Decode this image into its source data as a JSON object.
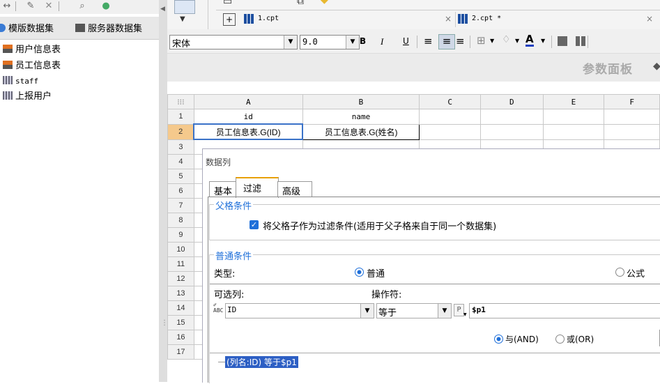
{
  "left_panel": {
    "tabs": [
      "模版数据集",
      "服务器数据集"
    ],
    "datasets": [
      {
        "label": "用户信息表",
        "icon": "db-table-icon"
      },
      {
        "label": "员工信息表",
        "icon": "db-table-icon"
      },
      {
        "label": "staff",
        "icon": "embedded-table-icon"
      },
      {
        "label": "上报用户",
        "icon": "embedded-table-icon"
      }
    ]
  },
  "editor_tabs": [
    {
      "label": "1.cpt",
      "close": "×"
    },
    {
      "label": "2.cpt *",
      "close": "×"
    }
  ],
  "format_bar": {
    "font_name": "宋体",
    "font_size": "9.0",
    "bold": "B",
    "italic": "I",
    "underline": "U",
    "font_color_glyph": "A"
  },
  "param_panel": {
    "label": "参数面板"
  },
  "sheet": {
    "corner": "⁝⁝⁝",
    "columns": [
      "A",
      "B",
      "C",
      "D",
      "E",
      "F"
    ],
    "rows": [
      "1",
      "2",
      "3",
      "4",
      "5",
      "6",
      "7",
      "8",
      "9",
      "10",
      "11",
      "12",
      "13",
      "14",
      "15",
      "16",
      "17"
    ],
    "cells": {
      "A1": "id",
      "B1": "name",
      "A2": "员工信息表.G(ID)",
      "B2": "员工信息表.G(姓名)"
    }
  },
  "dialog": {
    "title": "数据列",
    "tabs": [
      "基本",
      "过滤",
      "高级"
    ],
    "active_tab": "过滤",
    "parent_section": {
      "legend": "父格条件",
      "checkbox_label": "将父格子作为过滤条件(适用于父子格来自于同一个数据集)",
      "checked": true
    },
    "normal_section": {
      "legend": "普通条件",
      "type_label": "类型:",
      "type_options": [
        {
          "label": "普通",
          "selected": true
        },
        {
          "label": "公式",
          "selected": false
        }
      ],
      "column_label": "可选列:",
      "operator_label": "操作符:",
      "column_value": "ID",
      "operator_value": "等于",
      "param_badge": "P",
      "value_text": "$p1",
      "logic_options": [
        {
          "label": "与(AND)",
          "selected": true
        },
        {
          "label": "或(OR)",
          "selected": false
        }
      ],
      "condition_tree": [
        "(列名:ID) 等于$p1"
      ]
    }
  },
  "colors": {
    "accent_blue": "#1e6fd9",
    "selection_orange": "#f5c98c",
    "tree_highlight": "#2d5fc4"
  }
}
